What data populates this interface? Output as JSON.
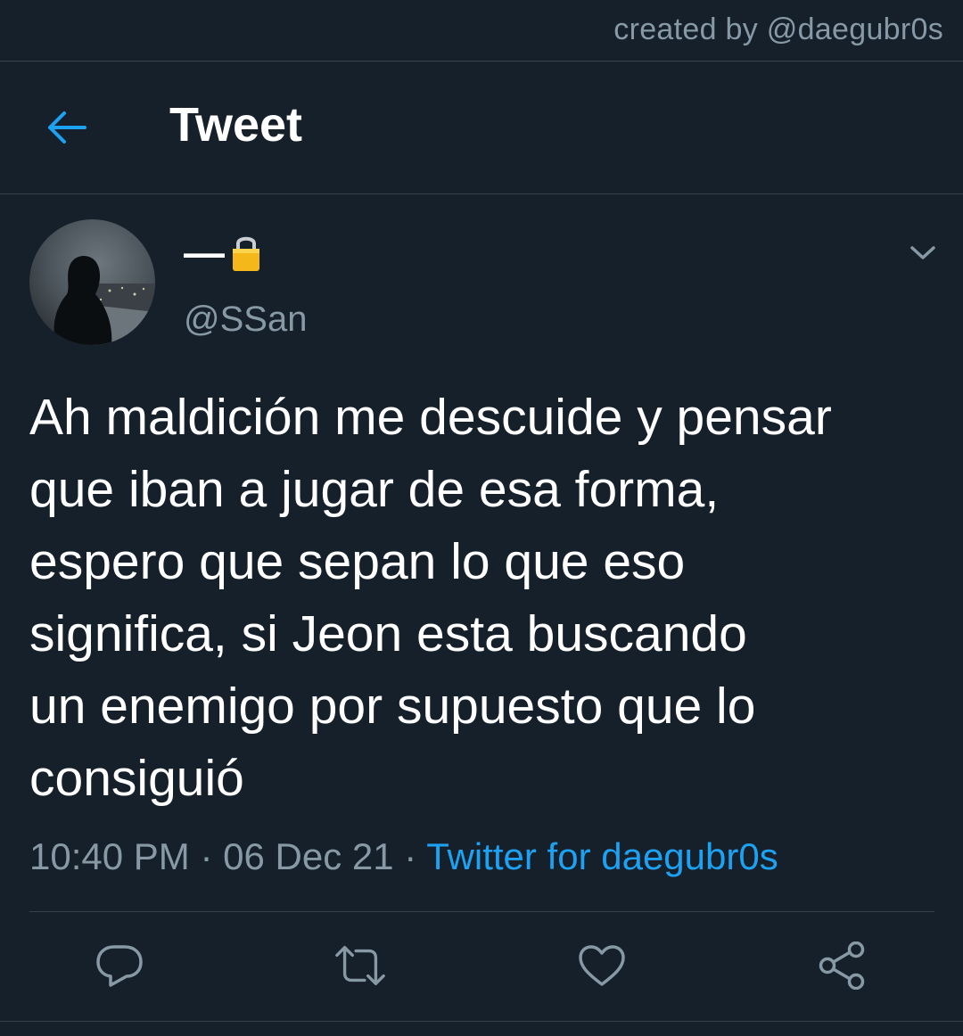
{
  "watermark": {
    "text": "created by @daegubr0s"
  },
  "header": {
    "title": "Tweet",
    "back_icon": "arrow-left-icon"
  },
  "tweet": {
    "display_name": "—",
    "display_name_icon": "lock-icon",
    "handle": "@SSan",
    "text_lines": [
      "Ah maldición me descuide y pensar",
      "que iban a jugar de esa forma,",
      "espero que sepan lo que eso",
      "significa, si Jeon esta buscando",
      "un enemigo por supuesto que lo",
      "consiguió"
    ],
    "time": "10:40 PM",
    "separator": "·",
    "date": "06 Dec 21",
    "source": "Twitter for daegubr0s"
  },
  "actions": [
    {
      "icon": "reply-icon"
    },
    {
      "icon": "retweet-icon"
    },
    {
      "icon": "like-icon"
    },
    {
      "icon": "share-icon"
    }
  ],
  "colors": {
    "background": "#15202b",
    "divider": "#38444d",
    "secondary_text": "#8899a6",
    "accent": "#1da1f2",
    "lock": "#f5b81a"
  }
}
